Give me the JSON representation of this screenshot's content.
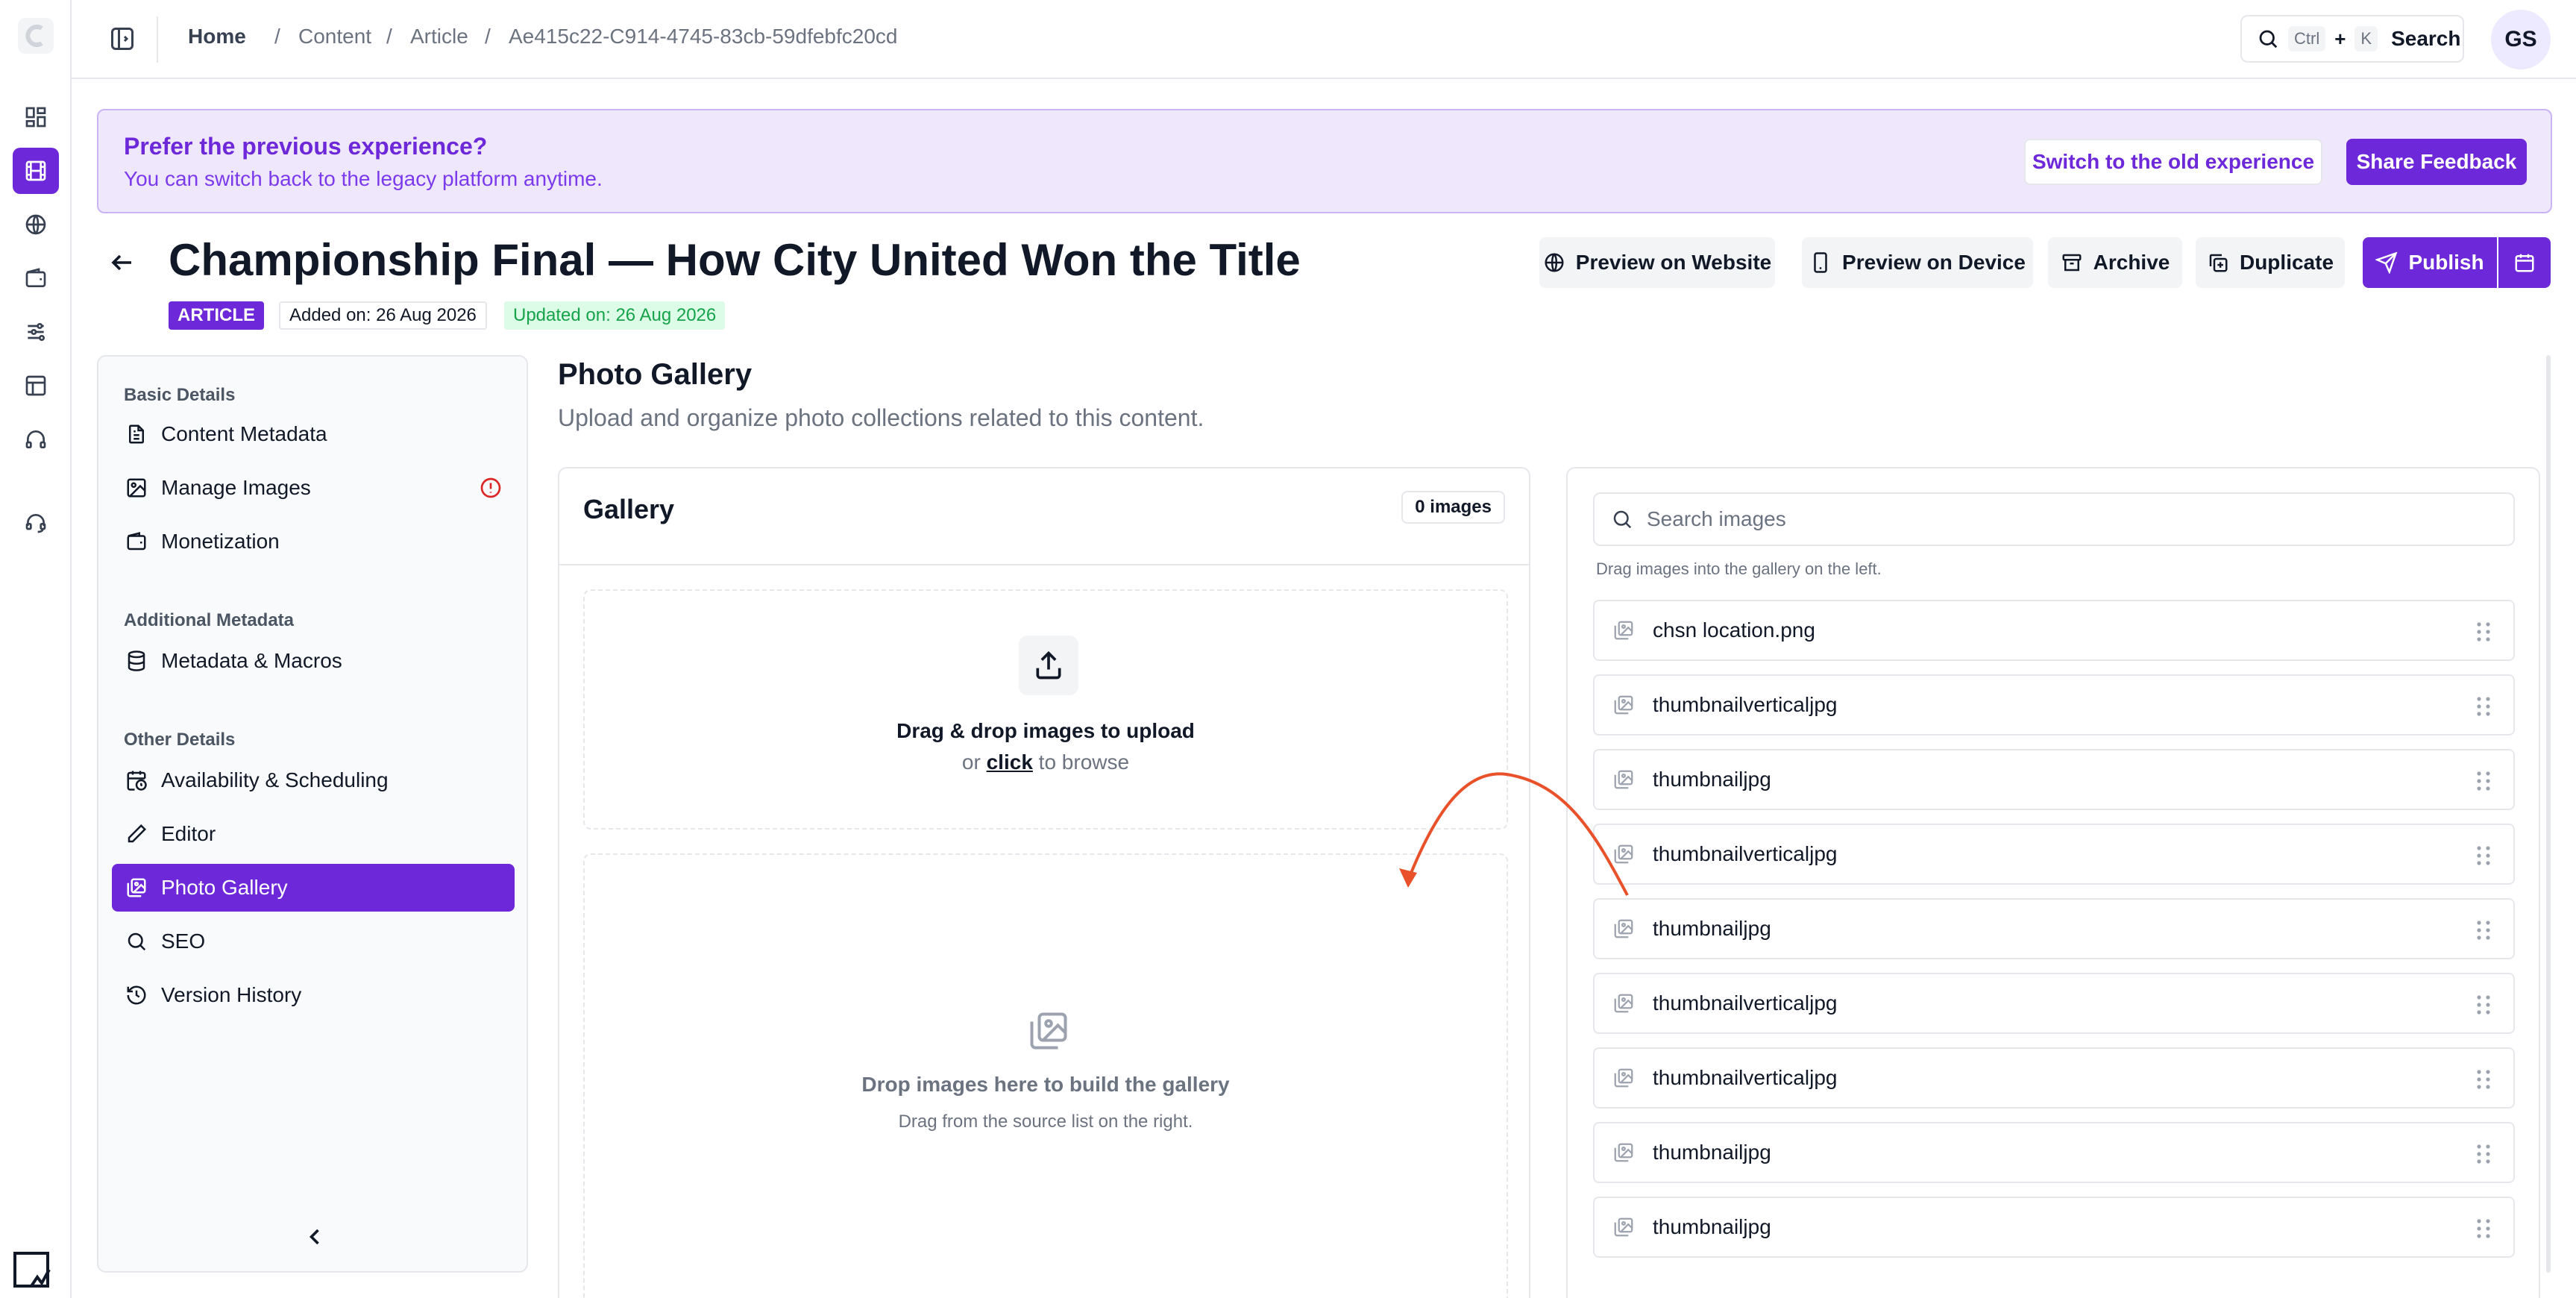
{
  "topbar": {
    "breadcrumb": [
      "Home",
      "Content",
      "Article",
      "Ae415c22-C914-4745-83cb-59dfebfc20cd"
    ],
    "search": {
      "key1": "Ctrl",
      "plus": "+",
      "key2": "K",
      "label": "Search"
    },
    "avatar": "GS"
  },
  "banner": {
    "title": "Prefer the previous experience?",
    "subtitle": "You can switch back to the legacy platform anytime.",
    "switch_label": "Switch to the old experience",
    "feedback_label": "Share Feedback"
  },
  "page": {
    "title": "Championship Final — How City United Won the Title",
    "type_badge": "ARTICLE",
    "added": "Added on: 26 Aug 2026",
    "updated": "Updated on: 26 Aug 2026",
    "actions": {
      "preview_web": "Preview on Website",
      "preview_device": "Preview on Device",
      "archive": "Archive",
      "duplicate": "Duplicate",
      "publish": "Publish"
    }
  },
  "sidenav": {
    "sections": [
      "Basic Details",
      "Additional Metadata",
      "Other Details"
    ],
    "items": [
      {
        "label": "Content Metadata",
        "icon": "document-icon"
      },
      {
        "label": "Manage Images",
        "icon": "image-icon",
        "alert": true
      },
      {
        "label": "Monetization",
        "icon": "wallet-icon"
      },
      {
        "label": "Metadata & Macros",
        "icon": "database-icon"
      },
      {
        "label": "Availability & Scheduling",
        "icon": "calendar-clock-icon"
      },
      {
        "label": "Editor",
        "icon": "pencil-icon"
      },
      {
        "label": "Photo Gallery",
        "icon": "gallery-icon",
        "active": true
      },
      {
        "label": "SEO",
        "icon": "search-icon"
      },
      {
        "label": "Version History",
        "icon": "history-icon"
      }
    ]
  },
  "content": {
    "title": "Photo Gallery",
    "subtitle": "Upload and organize photo collections related to this content."
  },
  "gallery": {
    "title": "Gallery",
    "count": "0 images",
    "upload_title": "Drag & drop images to upload",
    "upload_or": "or",
    "upload_click": "click",
    "upload_rest": "to browse",
    "drop_title": "Drop images here to build the gallery",
    "drop_sub": "Drag from the source list on the right."
  },
  "source": {
    "placeholder": "Search images",
    "hint": "Drag images into the gallery on the left.",
    "items": [
      "chsn location.png",
      "thumbnailverticaljpg",
      "thumbnailjpg",
      "thumbnailverticaljpg",
      "thumbnailjpg",
      "thumbnailverticaljpg",
      "thumbnailverticaljpg",
      "thumbnailjpg",
      "thumbnailjpg"
    ]
  },
  "colors": {
    "accent": "#6d28d9",
    "banner_bg": "#efe7fc",
    "success": "#16a34a",
    "arrow": "#e8512a",
    "warning": "#dc2626"
  }
}
